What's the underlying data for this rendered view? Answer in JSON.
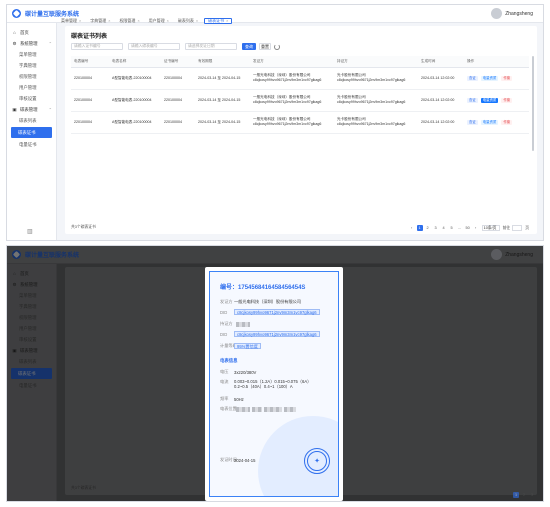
{
  "app": {
    "title": "碳计量互联服务系统",
    "user": "Zhangsheng"
  },
  "sidebar": {
    "items": [
      {
        "label": "首页",
        "icon": "home-icon"
      },
      {
        "label": "系统管理",
        "icon": "settings-icon"
      },
      {
        "label": "菜单管理",
        "sub": true
      },
      {
        "label": "字典管理",
        "sub": true
      },
      {
        "label": "权限管理",
        "sub": true
      },
      {
        "label": "用户管理",
        "sub": true
      },
      {
        "label": "审核设置",
        "sub": true
      },
      {
        "label": "碳表管理",
        "icon": "meter-icon"
      },
      {
        "label": "碳表列表",
        "sub": true
      },
      {
        "label": "碳表证书",
        "sub": true,
        "active": true
      },
      {
        "label": "电量证书",
        "sub": true
      }
    ]
  },
  "tabs": [
    {
      "label": "菜单管理"
    },
    {
      "label": "字典管理"
    },
    {
      "label": "权限管理"
    },
    {
      "label": "用户管理"
    },
    {
      "label": "碳表列表"
    },
    {
      "label": "碳表证书",
      "active": true
    }
  ],
  "page": {
    "title": "碳表证书列表",
    "filters": {
      "cert_placeholder": "请输入证书编号",
      "meter_placeholder": "请输入碳表编号",
      "date_placeholder": "请选择发证日期"
    },
    "search_label": "查询",
    "reset_label": "重置",
    "columns": [
      "电表编号",
      "电表名称",
      "证书编号",
      "有效期限",
      "发证方",
      "持证方",
      "生成时间",
      "操作"
    ],
    "rows": [
      {
        "meter_no": "220100004",
        "meter_name": "A型智能电表-220100004",
        "cert_no": "220100004",
        "validity": "2024-03-14 至 2024-04-15",
        "issuer": "一般光电科技（深圳）股份有限公司",
        "issuer_hash": "c8cjkosy99hvo9671j2nv9m3m1vc97glkag6",
        "holder": "光卡股份有限公司",
        "holder_hash": "c8cjkosy99hvo9671j2nv9m3m1vc97glkag6",
        "created": "2024-03-14 12:02:00"
      },
      {
        "meter_no": "220100004",
        "meter_name": "A型智能电表-220100004",
        "cert_no": "220100004",
        "validity": "2024-03-14 至 2024-04-15",
        "issuer": "一般光电科技（深圳）股份有限公司",
        "issuer_hash": "c8cjkosy99hvo9671j2nv9m3m1vc97glkag6",
        "holder": "光卡股份有限公司",
        "holder_hash": "c8cjkosy99hvo9671j2nv9m3m1vc97glkag6",
        "created": "2024-03-14 12:02:00"
      },
      {
        "meter_no": "220100004",
        "meter_name": "A型智能电表-220100004",
        "cert_no": "220100004",
        "validity": "2024-03-14 至 2024-04-15",
        "issuer": "一般光电科技（深圳）股份有限公司",
        "issuer_hash": "c8cjkosy99hvo9671j2nv9m3m1vc97glkag6",
        "holder": "光卡股份有限公司",
        "holder_hash": "c8cjkosy99hvo9671j2nv9m3m1vc97glkag6",
        "created": "2024-03-14 12:02:00"
      }
    ],
    "ops": {
      "view": "查证",
      "cert": "电量资质",
      "void": "作废"
    },
    "total": "共3个碳表证书",
    "pager": {
      "pages": [
        "1",
        "2",
        "3",
        "4",
        "5",
        "...",
        "50"
      ],
      "size": "10条/页",
      "goto": "前往",
      "page_unit": "页"
    }
  },
  "certificate": {
    "no_label": "编号：",
    "no": "1754568416458456454S",
    "issuer_label": "发证方",
    "issuer": "一般光电科技（深圳）股份有限公司",
    "did_label": "DID",
    "did": "c8cjkosy99hvo9671j2nv9m3m1vc97glkag6",
    "holder_label": "持证方",
    "holder_did_label": "DID",
    "holder_did": "c8cjkosy99hvo9671j2nv9m3m1vc97glkag6",
    "level_label": "计量等级",
    "level": "95%置信度",
    "section": "电表信息",
    "voltage_label": "电压",
    "voltage": "3x220/380V",
    "current_label": "电流",
    "current": "0.003~0.015（1.2A）0.015~0.075（6A）0.2~0.5（40A）0.4~1（100）A",
    "freq_label": "频率",
    "freq": "50Hz",
    "location_label": "电表位置",
    "date_label": "发证时间",
    "date": "2024-04-15"
  },
  "colors": {
    "primary": "#2f6fed",
    "danger": "#e5484d"
  }
}
